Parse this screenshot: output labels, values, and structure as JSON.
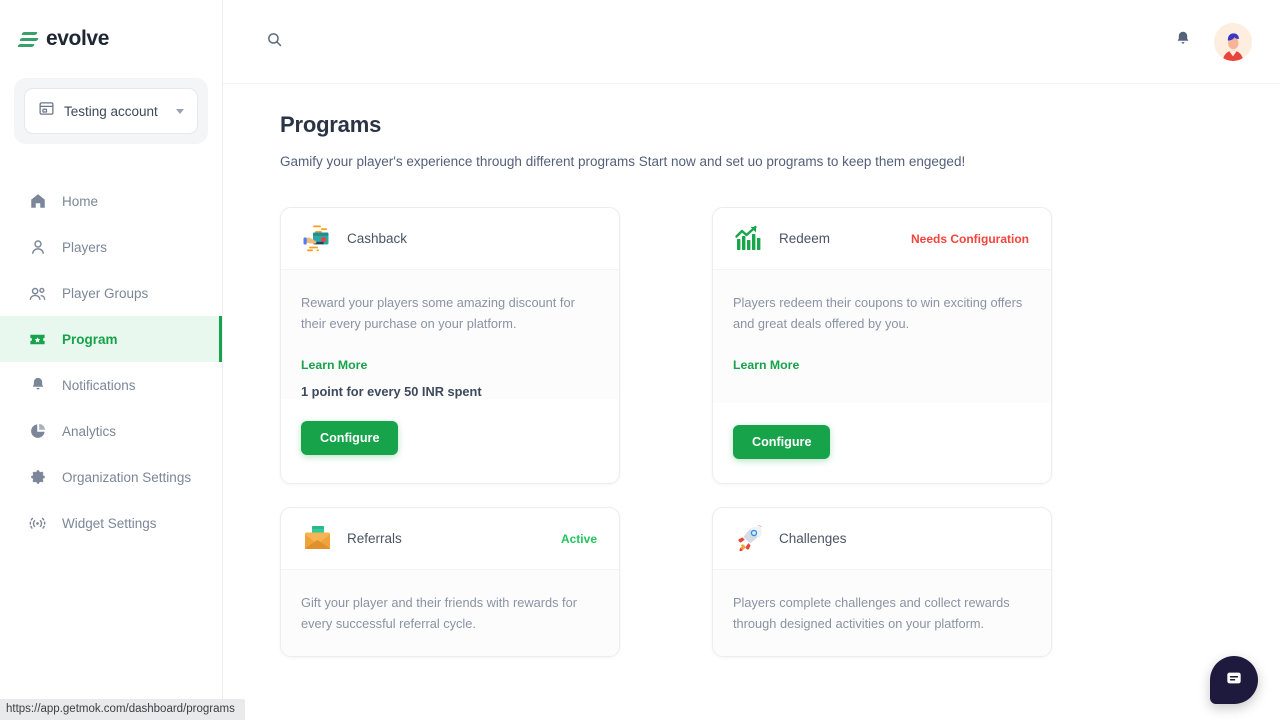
{
  "brand": {
    "name": "evolve",
    "accent": "#16a34a"
  },
  "sidebar": {
    "account": {
      "label": "Testing account",
      "icon": "store-icon"
    },
    "items": [
      {
        "label": "Home",
        "icon": "home-icon",
        "active": false
      },
      {
        "label": "Players",
        "icon": "user-icon",
        "active": false
      },
      {
        "label": "Player Groups",
        "icon": "users-icon",
        "active": false
      },
      {
        "label": "Program",
        "icon": "ticket-star-icon",
        "active": true
      },
      {
        "label": "Notifications",
        "icon": "bell-icon",
        "active": false
      },
      {
        "label": "Analytics",
        "icon": "pie-chart-icon",
        "active": false
      },
      {
        "label": "Organization Settings",
        "icon": "gear-icon",
        "active": false
      },
      {
        "label": "Widget Settings",
        "icon": "broadcast-icon",
        "active": false
      }
    ]
  },
  "topbar": {
    "search_icon": "search-icon",
    "bell_icon": "bell-icon",
    "avatar_alt": "user-avatar"
  },
  "page": {
    "title": "Programs",
    "subtitle": "Gamify your player's experience through different programs Start now and set uo programs to keep them engeged!"
  },
  "cards": [
    {
      "title": "Cashback",
      "icon": "cashback-icon",
      "badge": "",
      "badge_kind": "",
      "description": "Reward your players some amazing discount for their every purchase on your platform.",
      "learn_more": "Learn More",
      "rule": "1 point for every 50 INR spent",
      "button": "Configure"
    },
    {
      "title": "Redeem",
      "icon": "chart-growth-icon",
      "badge": "Needs Configuration",
      "badge_kind": "warn",
      "description": "Players redeem their coupons to win exciting offers and great deals offered by you.",
      "learn_more": "Learn More",
      "rule": "",
      "button": "Configure"
    },
    {
      "title": "Referrals",
      "icon": "envelope-money-icon",
      "badge": "Active",
      "badge_kind": "ok",
      "description": "Gift your player and their friends with rewards for every successful referral cycle.",
      "learn_more": "",
      "rule": "",
      "button": ""
    },
    {
      "title": "Challenges",
      "icon": "rocket-icon",
      "badge": "",
      "badge_kind": "",
      "description": "Players complete challenges and collect rewards through designed activities on your platform.",
      "learn_more": "",
      "rule": "",
      "button": ""
    }
  ],
  "chat_widget": {
    "icon": "chat-bubble-icon"
  },
  "status_bar": {
    "url": "https://app.getmok.com/dashboard/programs"
  }
}
